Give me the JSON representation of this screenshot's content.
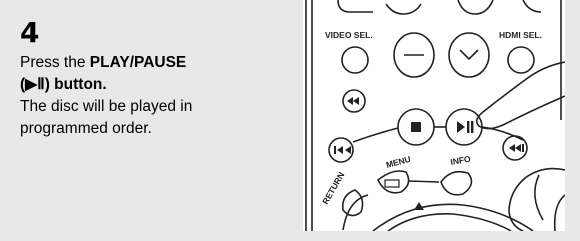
{
  "step": {
    "number": "4"
  },
  "instruction": {
    "line1_prefix": "Press the ",
    "play_label": "PLAY",
    "slash": "/",
    "pause_label": "PAUSE",
    "line2": "(▶Ⅱ) button.",
    "line3": "The disc will be played in",
    "line4": "programmed order."
  },
  "remote": {
    "video_sel_label": "VIDEO SEL.",
    "hdmi_sel_label": "HDMI SEL.",
    "menu_label": "MENU",
    "info_label": "INFO",
    "return_label": "RETURN"
  }
}
